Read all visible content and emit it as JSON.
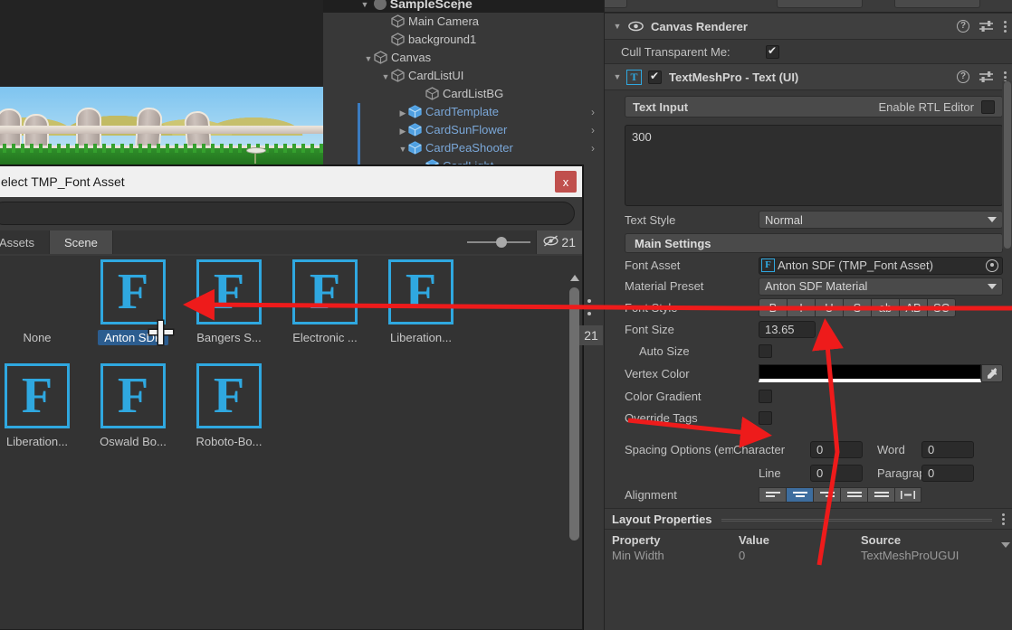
{
  "game_view": {
    "name": "scene-preview",
    "description": "PvZ style fence and grass background"
  },
  "hierarchy": {
    "root_label": "SampleScene",
    "items": [
      {
        "label": "Main Camera",
        "indent": 3,
        "expandable": false,
        "prefab": false,
        "selected_bar": false,
        "chevron": false
      },
      {
        "label": "background1",
        "indent": 3,
        "expandable": false,
        "prefab": false,
        "selected_bar": false,
        "chevron": false
      },
      {
        "label": "Canvas",
        "indent": 2,
        "expandable": true,
        "prefab": false,
        "selected_bar": false,
        "chevron": false,
        "twisty": "▼"
      },
      {
        "label": "CardListUI",
        "indent": 3,
        "expandable": true,
        "prefab": false,
        "selected_bar": false,
        "chevron": false,
        "twisty": "▼"
      },
      {
        "label": "CardListBG",
        "indent": 5,
        "expandable": false,
        "prefab": false,
        "selected_bar": false,
        "chevron": false
      },
      {
        "label": "CardTemplate",
        "indent": 4,
        "expandable": true,
        "prefab": true,
        "selected_bar": true,
        "chevron": true,
        "twisty": "▶"
      },
      {
        "label": "CardSunFlower",
        "indent": 4,
        "expandable": true,
        "prefab": true,
        "selected_bar": true,
        "chevron": true,
        "twisty": "▶"
      },
      {
        "label": "CardPeaShooter",
        "indent": 4,
        "expandable": true,
        "prefab": true,
        "selected_bar": true,
        "chevron": true,
        "twisty": "▼"
      },
      {
        "label": "CardLight",
        "indent": 5,
        "expandable": false,
        "prefab": true,
        "selected_bar": true,
        "chevron": false
      }
    ]
  },
  "inspector": {
    "canvas_renderer": {
      "title": "Canvas Renderer",
      "cull_label": "Cull Transparent Me:",
      "cull_checked": true
    },
    "tmp_text": {
      "title": "TextMeshPro - Text (UI)",
      "enabled": true,
      "icon_letter": "T",
      "text_input_label": "Text Input",
      "rtl_label": "Enable RTL Editor",
      "rtl_checked": false,
      "text_value": "300",
      "text_style_label": "Text Style",
      "text_style_value": "Normal",
      "main_settings_label": "Main Settings",
      "font_asset_label": "Font Asset",
      "font_asset_value": "Anton SDF (TMP_Font Asset)",
      "font_asset_icon": "F",
      "material_preset_label": "Material Preset",
      "material_preset_value": "Anton SDF Material",
      "font_style_label": "Font Style",
      "font_style_buttons": [
        "B",
        "I",
        "U",
        "S",
        "ab",
        "AB",
        "SC"
      ],
      "font_size_label": "Font Size",
      "font_size_value": "13.65",
      "auto_size_label": "Auto Size",
      "auto_size_checked": false,
      "vertex_color_label": "Vertex Color",
      "vertex_color_value": "#000000",
      "color_gradient_label": "Color Gradient",
      "color_gradient_checked": false,
      "override_tags_label": "Override Tags",
      "override_tags_checked": false,
      "spacing_label": "Spacing Options (em",
      "spacing": {
        "character_label": "Character",
        "character_value": "0",
        "word_label": "Word",
        "word_value": "0",
        "line_label": "Line",
        "line_value": "0",
        "paragraph_label": "Paragraph",
        "paragraph_value": "0"
      },
      "alignment_label": "Alignment",
      "alignment_active_index": 1
    },
    "layout_properties": {
      "title": "Layout Properties",
      "columns": [
        "Property",
        "Value",
        "Source"
      ],
      "rows": [
        {
          "property": "Min Width",
          "value": "0",
          "source": "TextMeshProUGUI"
        }
      ]
    }
  },
  "picker": {
    "title": "elect TMP_Font Asset",
    "close_label": "x",
    "search_value": "",
    "search_placeholder": "",
    "tabs": [
      {
        "label": "Assets",
        "active": true
      },
      {
        "label": "Scene",
        "active": false
      }
    ],
    "hidden_count": "21",
    "side_count": "21",
    "assets": [
      {
        "label": "None",
        "thumb": false,
        "selected": false
      },
      {
        "label": "Anton SDF",
        "thumb": true,
        "selected": true
      },
      {
        "label": "Bangers S...",
        "thumb": true,
        "selected": false
      },
      {
        "label": "Electronic ...",
        "thumb": true,
        "selected": false
      },
      {
        "label": "Liberation...",
        "thumb": true,
        "selected": false
      },
      {
        "label": "Liberation...",
        "thumb": true,
        "selected": false
      },
      {
        "label": "Oswald Bo...",
        "thumb": true,
        "selected": false
      },
      {
        "label": "Roboto-Bo...",
        "thumb": true,
        "selected": false
      }
    ],
    "thumb_glyph": "F"
  },
  "annotations": {
    "arrow_color": "#ee1b1b",
    "arrows": [
      {
        "name": "arrow-font-asset-to-anton",
        "desc": "from Font Asset field left to Anton SDF thumbnail"
      },
      {
        "name": "arrow-vertex-color",
        "desc": "from left into Vertex Color swatch"
      },
      {
        "name": "arrow-up-to-font-asset",
        "desc": "from Vertex Color up to Font Asset value"
      }
    ]
  }
}
